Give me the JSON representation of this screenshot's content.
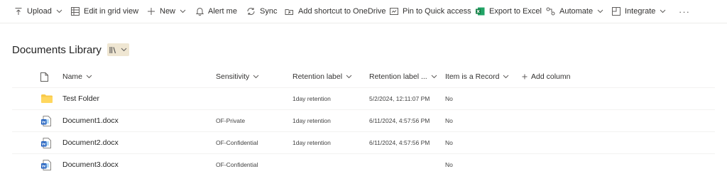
{
  "commandbar": {
    "upload": "Upload",
    "edit_grid": "Edit in grid view",
    "new": "New",
    "alert": "Alert me",
    "sync": "Sync",
    "shortcut": "Add shortcut to OneDrive",
    "pin": "Pin to Quick access",
    "export": "Export to Excel",
    "automate": "Automate",
    "integrate": "Integrate",
    "more": "···"
  },
  "library": {
    "title": "Documents Library"
  },
  "columns": {
    "name": "Name",
    "sensitivity": "Sensitivity",
    "retention_label": "Retention label",
    "retention_label_applied": "Retention label ...",
    "is_record": "Item is a Record",
    "add_column": "Add column"
  },
  "rows": [
    {
      "type": "folder",
      "name": "Test Folder",
      "sensitivity": "",
      "retention": "1day retention",
      "retention_date": "5/2/2024, 12:11:07 PM",
      "is_record": "No"
    },
    {
      "type": "word",
      "name": "Document1.docx",
      "sensitivity": "OF-Private",
      "retention": "1day retention",
      "retention_date": "6/11/2024, 4:57:56 PM",
      "is_record": "No"
    },
    {
      "type": "word",
      "name": "Document2.docx",
      "sensitivity": "OF-Confidential",
      "retention": "1day retention",
      "retention_date": "6/11/2024, 4:57:56 PM",
      "is_record": "No"
    },
    {
      "type": "word",
      "name": "Document3.docx",
      "sensitivity": "OF-Confidential",
      "retention": "",
      "retention_date": "",
      "is_record": "No"
    }
  ],
  "colors": {
    "folder": "#f8c94a",
    "word_blue": "#185abd",
    "excel_green": "#107c41",
    "view_switch_bg": "#efe6d2"
  }
}
